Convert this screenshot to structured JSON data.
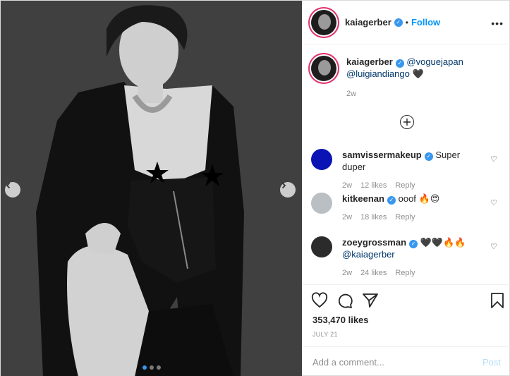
{
  "post": {
    "username": "kaiagerber",
    "follow_label": "Follow",
    "separator": "•",
    "more": "•••"
  },
  "caption": {
    "username": "kaiagerber",
    "mention1": "@voguejapan",
    "mention2": "@luigiandiango",
    "emoji": "🖤",
    "age": "2w"
  },
  "comments": [
    {
      "username": "samvissermakeup",
      "text": "Super duper",
      "age": "2w",
      "likes": "12 likes",
      "reply": "Reply",
      "avatar_color": "#0a14b4"
    },
    {
      "username": "kitkeenan",
      "text": "ooof 🔥😍",
      "age": "2w",
      "likes": "18 likes",
      "reply": "Reply",
      "avatar_color": "#b9bfc3"
    },
    {
      "username": "zoeygrossman",
      "text": "🖤🖤🔥🔥",
      "mention": "@kaiagerber",
      "age": "2w",
      "likes": "24 likes",
      "reply": "Reply",
      "avatar_color": "#2b2b2b"
    }
  ],
  "stats": {
    "likes": "353,470 likes",
    "date": "JULY 21"
  },
  "composer": {
    "placeholder": "Add a comment...",
    "post_label": "Post"
  },
  "carousel": {
    "slides": 3,
    "active": 1
  },
  "colors": {
    "accent": "#0095f6",
    "verified": "#3897f0",
    "link": "#00376b",
    "muted": "#8e8e8e"
  }
}
